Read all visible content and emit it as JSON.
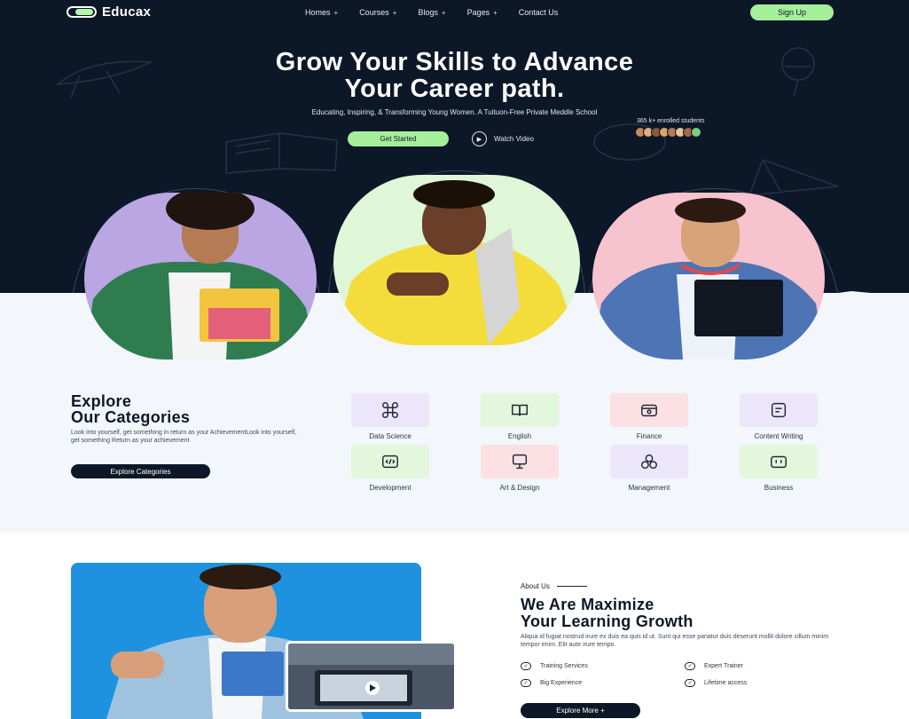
{
  "brand": {
    "name": "Educax"
  },
  "nav": {
    "items": [
      {
        "label": "Homes",
        "caret": "+"
      },
      {
        "label": "Courses",
        "caret": "+"
      },
      {
        "label": "Blogs",
        "caret": "+"
      },
      {
        "label": "Pages",
        "caret": "+"
      },
      {
        "label": "Contact Us",
        "caret": ""
      }
    ],
    "signup_label": "Sign Up"
  },
  "hero": {
    "title_line1": "Grow Your Skills to Advance",
    "title_line2": "Your Career path.",
    "subtitle": "Educating, Inspiring, & Transforming Young Women. A Tuituon-Free Private Meddle School",
    "get_started_label": "Get Started",
    "watch_label": "Watch Video",
    "enrolled_text": "365 k+ enrolled students",
    "avatar_colors": [
      "#c98a5a",
      "#e0b07a",
      "#8a5a3c",
      "#d9a36b",
      "#b57b54",
      "#e8c49a",
      "#a06a4a",
      "#7ad17a"
    ]
  },
  "categories": {
    "title_line1": "Explore",
    "title_line2": "Our Categories",
    "description": "Look into yourself, get something in return as your AchievementLook into yourself, get something Return as your achievement",
    "button_label": "Explore Categories",
    "items": [
      {
        "label": "Data Science",
        "icon": "command-icon",
        "bg": "#ece6fb"
      },
      {
        "label": "English",
        "icon": "book-icon",
        "bg": "#e3f7dc"
      },
      {
        "label": "Finance",
        "icon": "wallet-icon",
        "bg": "#fbe1e4"
      },
      {
        "label": "Content Writing",
        "icon": "document-icon",
        "bg": "#ece6fb"
      },
      {
        "label": "Development",
        "icon": "code-icon",
        "bg": "#e3f7dc"
      },
      {
        "label": "Art & Design",
        "icon": "monitor-icon",
        "bg": "#fbe1e4"
      },
      {
        "label": "Management",
        "icon": "people-icon",
        "bg": "#ece6fb"
      },
      {
        "label": "Business",
        "icon": "briefcase-icon",
        "bg": "#e3f7dc"
      }
    ]
  },
  "about": {
    "kicker": "About Us",
    "title_line1": "We Are Maximize",
    "title_line2": "Your Learning Growth",
    "description": "Aliqua id fugiat nostrud irure ex duis ea quis id ut. Sunt qui esse pariatur duis deserunt mollit dolore cillum minim tempor enim. Elit aute irure tempo.",
    "features": [
      "Training Services",
      "Expert Trainer",
      "Big Experience",
      "Lifetime access"
    ],
    "button_label": "Explore More +"
  },
  "colors": {
    "navy": "#0c1728",
    "accent_green": "#a5ef9a",
    "arch_purple": "#b9a6e2",
    "arch_mint": "#dff7d6",
    "arch_pink": "#f6c3ce"
  }
}
